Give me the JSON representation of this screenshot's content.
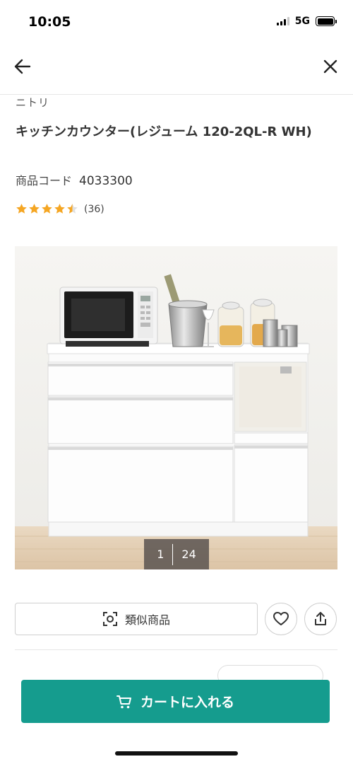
{
  "status_bar": {
    "time": "10:05",
    "network": "5G"
  },
  "nav": {
    "back_icon": "arrow-left-icon",
    "close_icon": "close-icon"
  },
  "product": {
    "brand": "ニトリ",
    "title": "キッチンカウンター(レジューム 120-2QL-R WH)",
    "code_label": "商品コード",
    "code_value": "4033300",
    "rating": 4.5,
    "review_count": "(36)"
  },
  "gallery": {
    "current": "1",
    "total": "24"
  },
  "actions": {
    "similar_label": "類似商品",
    "favorite_icon": "heart-icon",
    "share_icon": "share-icon"
  },
  "cart": {
    "label": "カートに入れる",
    "icon": "cart-icon"
  },
  "colors": {
    "accent": "#159c8e",
    "star": "#f5a623"
  }
}
